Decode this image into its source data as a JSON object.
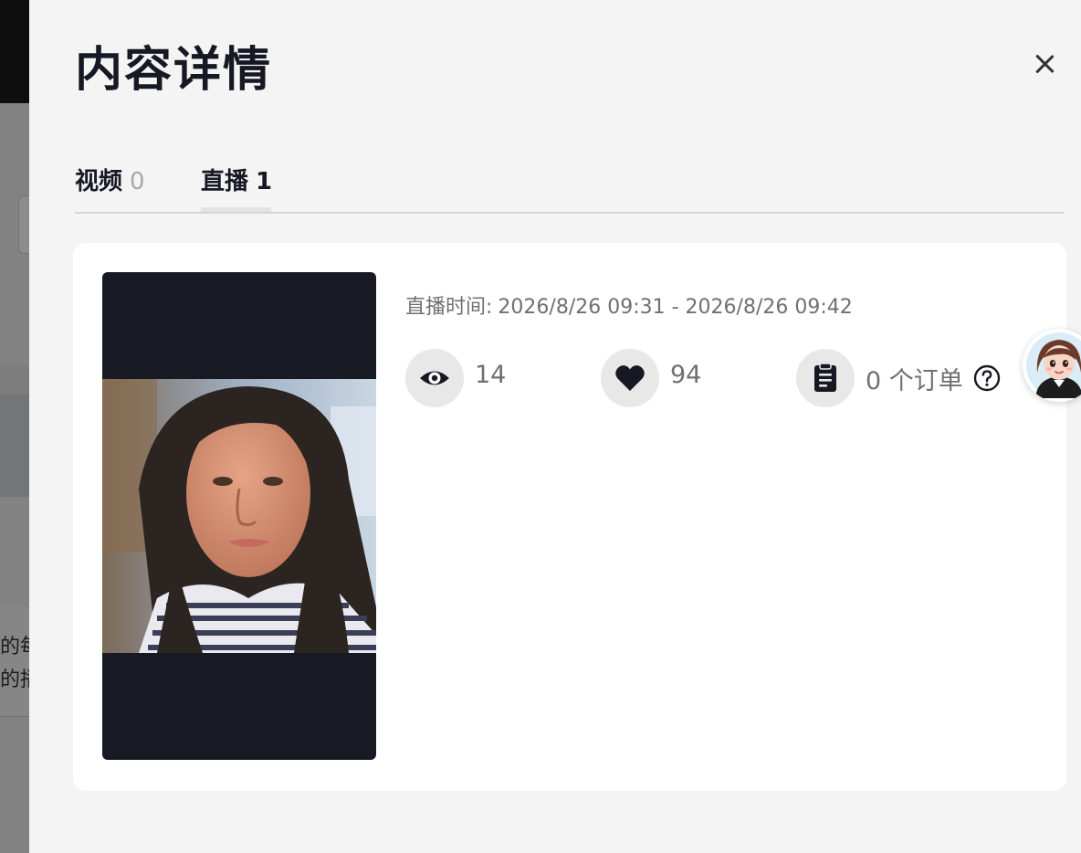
{
  "background": {
    "snippet_line1": "的每",
    "snippet_line2": "的播"
  },
  "drawer": {
    "title": "内容详情",
    "close_icon": "close-icon"
  },
  "tabs": [
    {
      "label": "视频",
      "count": "0",
      "active": false
    },
    {
      "label": "直播",
      "count": "1",
      "active": true
    }
  ],
  "live_card": {
    "time_label": "直播时间:",
    "time_range": "2026/8/26 09:31 - 2026/8/26 09:42",
    "stats": {
      "views": {
        "icon": "eye-icon",
        "value": "14"
      },
      "likes": {
        "icon": "heart-icon",
        "value": "94"
      },
      "orders": {
        "icon": "order-list-icon",
        "value": "0 个订单",
        "help_icon": "question-circle-icon"
      }
    }
  },
  "assistant": {
    "icon": "assistant-avatar-icon"
  }
}
